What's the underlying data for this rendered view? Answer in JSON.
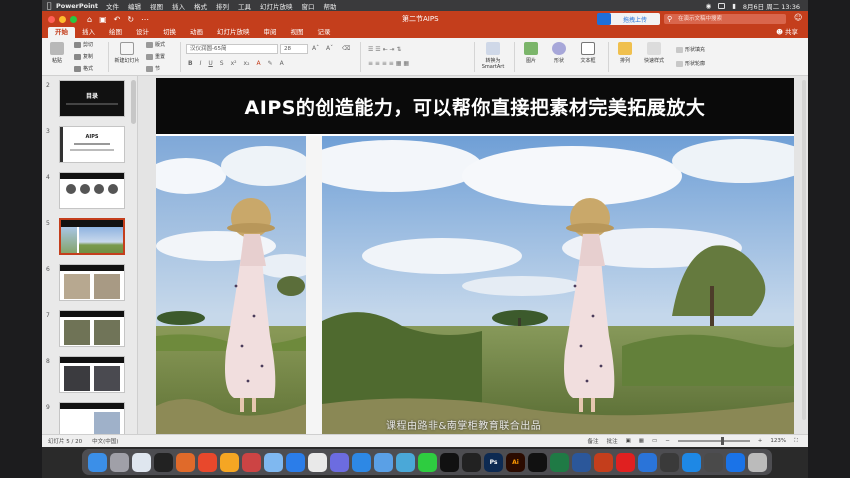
{
  "menubar": {
    "app_name": "PowerPoint",
    "menus": [
      "文件",
      "编辑",
      "视图",
      "插入",
      "格式",
      "排列",
      "工具",
      "幻灯片放映",
      "窗口",
      "帮助"
    ],
    "clock": "8月6日 周二  13:36"
  },
  "titlebar": {
    "doc_title": "第二节AIPS",
    "cloud_label": "拖拽上传",
    "search_placeholder": "在演示文稿中搜索"
  },
  "ribbon": {
    "tabs": [
      "开始",
      "插入",
      "绘图",
      "设计",
      "切换",
      "动画",
      "幻灯片放映",
      "审阅",
      "视图",
      "记录"
    ],
    "active_tab": "开始",
    "share_label": "共享",
    "paste": "粘贴",
    "cut": "剪切",
    "copy": "复制",
    "format_painter": "格式",
    "new_slide": "新建幻灯片",
    "layout": "版式",
    "reset": "重置",
    "section": "节",
    "font_name": "汉仪润圆-65简",
    "font_size": "28",
    "smartart": "转换为SmartArt",
    "picture": "图片",
    "shape": "形状",
    "textbox": "文本框",
    "arrange": "排列",
    "quick_styles": "快速样式",
    "shape_fill": "形状填充",
    "shape_outline": "形状轮廓"
  },
  "thumbnails": [
    {
      "num": "2",
      "title": "目录",
      "selected": false
    },
    {
      "num": "3",
      "title": "AIPS",
      "selected": false
    },
    {
      "num": "4",
      "title": "",
      "selected": false
    },
    {
      "num": "5",
      "title": "",
      "selected": true
    },
    {
      "num": "6",
      "title": "",
      "selected": false
    },
    {
      "num": "7",
      "title": "",
      "selected": false
    },
    {
      "num": "8",
      "title": "",
      "selected": false
    },
    {
      "num": "9",
      "title": "",
      "selected": false
    }
  ],
  "slide": {
    "title": "AIPS的创造能力，可以帮你直接把素材完美拓展放大",
    "subtitle": "课程由路非&南掌柜教育联合出品"
  },
  "statusbar": {
    "slide_info": "幻灯片 5 / 20",
    "language": "中文(中国)",
    "notes": "备注",
    "comments": "批注",
    "zoom": "123%",
    "zoom_level": 0.62
  },
  "colors": {
    "accent": "#c43e1c",
    "ribbon_bg": "#f3f3f3",
    "title_bar_bg": "#0a0a0a"
  },
  "dock_apps": [
    "finder-icon",
    "launchpad-icon",
    "app-icon",
    "chatgpt-icon",
    "app-icon",
    "weibo-icon",
    "app-icon",
    "app-icon",
    "app-icon",
    "safari-icon",
    "app-icon",
    "app-icon",
    "app-icon",
    "app-icon",
    "app-icon",
    "wechat-icon",
    "qq-icon",
    "terminal-icon",
    "photoshop-icon",
    "illustrator-icon",
    "capcut-icon",
    "excel-icon",
    "word-icon",
    "powerpoint-icon",
    "app-icon",
    "app-icon",
    "app-icon",
    "app-icon",
    "app-icon",
    "app-icon",
    "trash-icon"
  ]
}
